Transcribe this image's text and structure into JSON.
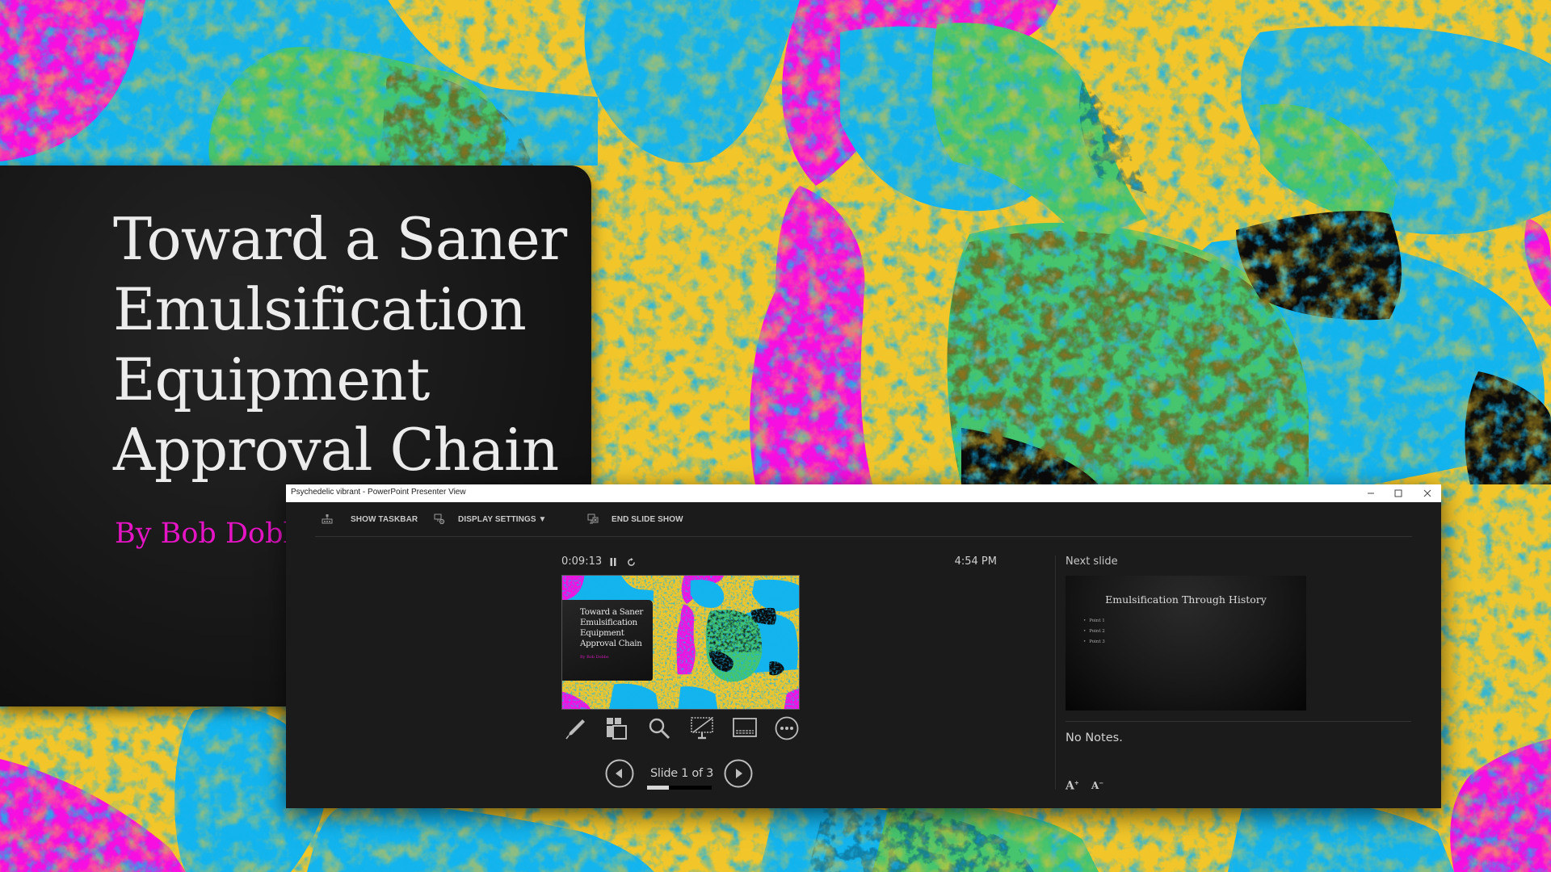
{
  "colors": {
    "bg_yellow": "#f2c62a",
    "bg_blue": "#14b4ee",
    "bg_green": "#46c46e",
    "bg_magenta": "#f70ee0",
    "bg_black": "#0a0a0a",
    "panel_bg": "#1b1b1b",
    "byline_magenta": "#e514c4"
  },
  "slide": {
    "title_lines": [
      "Toward a Saner",
      "Emulsification",
      "Equipment",
      "Approval Chain"
    ],
    "byline": "By Bob Dobbs"
  },
  "window": {
    "title": "Psychedelic vibrant - PowerPoint Presenter View",
    "controls": {
      "minimize": "minimize-icon",
      "maximize": "maximize-icon",
      "close": "close-icon"
    }
  },
  "toolbar": {
    "show_taskbar": "SHOW TASKBAR",
    "display_settings": "DISPLAY SETTINGS ▼",
    "end_slide_show": "END SLIDE SHOW"
  },
  "presenter": {
    "elapsed": "0:09:13",
    "clock": "4:54 PM",
    "timer_controls": [
      "pause-icon",
      "reset-icon"
    ],
    "tools": [
      "pen-icon",
      "see-all-slides-icon",
      "zoom-icon",
      "black-screen-icon",
      "subtitles-icon",
      "more-options-icon"
    ],
    "slide_counter": "Slide 1 of 3",
    "current_slide": 1,
    "total_slides": 3,
    "progress_fraction": 0.333
  },
  "next": {
    "label": "Next slide",
    "title": "Emulsification Through History",
    "bullets": [
      "Point 1",
      "Point 2",
      "Point 3"
    ]
  },
  "notes": {
    "text": "No Notes.",
    "increase_font": "A",
    "decrease_font": "A"
  }
}
